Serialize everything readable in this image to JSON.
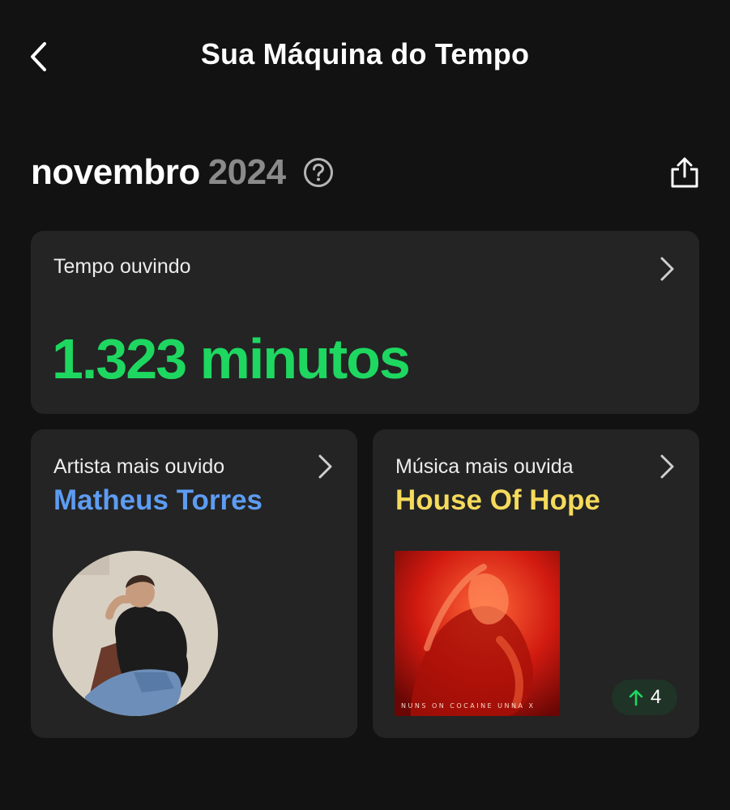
{
  "header": {
    "title": "Sua Máquina do Tempo"
  },
  "period": {
    "month": "novembro",
    "year": "2024"
  },
  "listening_time": {
    "label": "Tempo ouvindo",
    "value": "1.323 minutos"
  },
  "top_artist": {
    "label": "Artista mais ouvido",
    "name": "Matheus Torres"
  },
  "top_song": {
    "label": "Música mais ouvida",
    "name": "House Of Hope",
    "cover_text": "NUNS ON COCAINE  UNNA X",
    "rank_change": "4"
  },
  "colors": {
    "background": "#121212",
    "card": "#242424",
    "minutes_green": "#1ed760",
    "artist_blue": "#5d9cf2",
    "song_yellow": "#f5da5c",
    "badge_bg": "#1f3327"
  },
  "icons": [
    "back-arrow-icon",
    "help-icon",
    "share-icon",
    "chevron-right-icon",
    "arrow-up-icon"
  ]
}
